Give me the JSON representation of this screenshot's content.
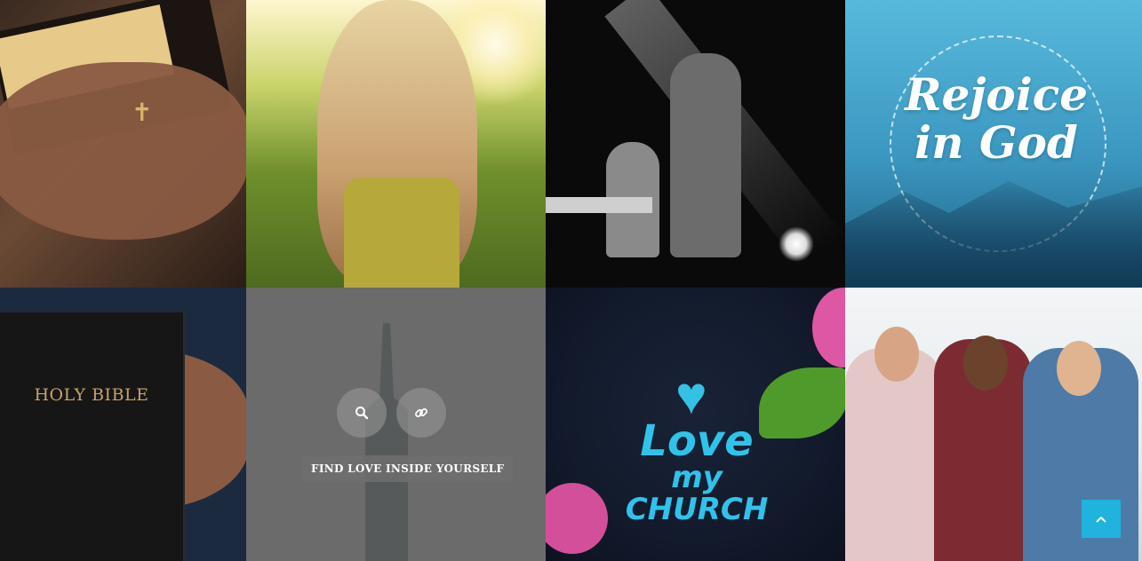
{
  "gallery": {
    "tiles": [
      {
        "subject": "hands holding open bible"
      },
      {
        "subject": "girl in sunlit field"
      },
      {
        "subject": "musicians on stage"
      },
      {
        "subject": "rejoice in god lettering",
        "text": "Rejoice in God"
      },
      {
        "subject": "hands holding holy bible",
        "text": "HOLY BIBLE"
      },
      {
        "subject": "city skyline",
        "hover_caption": "FIND LOVE INSIDE YOURSELF"
      },
      {
        "subject": "love my church lettering",
        "text_line1": "Love",
        "text_line2": "my",
        "text_line3": "CHURCH"
      },
      {
        "subject": "smiling young people"
      }
    ]
  },
  "actions": {
    "zoom_icon": "search-icon",
    "link_icon": "link-icon",
    "scroll_top_icon": "chevron-up-icon"
  },
  "colors": {
    "accent": "#1fb3dd",
    "overlay": "#5f5f5f"
  }
}
